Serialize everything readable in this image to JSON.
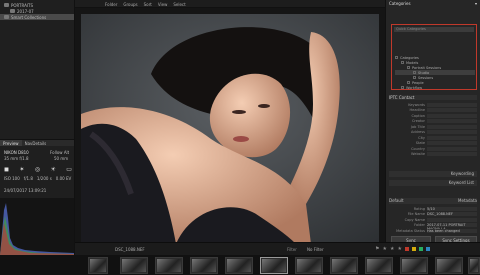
{
  "left_panel": {
    "tree": [
      {
        "label": "PORTRAITS",
        "selected": false,
        "level": 0
      },
      {
        "label": "2017-07",
        "selected": false,
        "level": 1
      },
      {
        "label": "Smart Collections",
        "selected": true,
        "level": 0
      }
    ],
    "tabs": [
      {
        "label": "Preview"
      },
      {
        "label": "NavDetails"
      }
    ],
    "camera": {
      "model": "NIKON D810",
      "lens": "35 mm f/1.8",
      "profile": "Follow Alt",
      "meta_right": "50 mm"
    },
    "exif": {
      "iso": "ISO 100",
      "shutter": "1/200 s",
      "aperture": "f/1.8",
      "wb": "1/3",
      "ev": "0.00 EV"
    },
    "date": "24/07/2017 13:09:21"
  },
  "top_bar": {
    "items": [
      "Folder",
      "Groups",
      "Sort",
      "View",
      "Select"
    ]
  },
  "right_panel": {
    "categories_title": "Categories",
    "search_placeholder": "Quick Categories",
    "tree": [
      {
        "label": "Categories",
        "level": 0
      },
      {
        "label": "Models",
        "level": 1
      },
      {
        "label": "Portrait Sessions",
        "level": 2
      },
      {
        "label": "Studio",
        "level": 3
      },
      {
        "label": "Sessions",
        "level": 3
      },
      {
        "label": "People",
        "level": 2
      },
      {
        "label": "Workflow",
        "level": 1
      }
    ],
    "fields_title": "IPTC Contact",
    "fields": [
      {
        "label": "Keywords",
        "value": ""
      },
      {
        "label": "Headline",
        "value": ""
      },
      {
        "label": "Caption",
        "value": ""
      },
      {
        "label": "Creator",
        "value": ""
      },
      {
        "label": "Job Title",
        "value": ""
      },
      {
        "label": "Address",
        "value": ""
      },
      {
        "label": "City",
        "value": ""
      },
      {
        "label": "State",
        "value": ""
      },
      {
        "label": "Country",
        "value": ""
      },
      {
        "label": "Website",
        "value": ""
      }
    ],
    "sections": [
      "Keywording",
      "Keyword List"
    ],
    "metadata": {
      "title": "Metadata",
      "preset_label": "Default",
      "rows": [
        {
          "label": "Rating",
          "value": "5/10"
        },
        {
          "label": "File Name",
          "value": "DSC_1088.NEF"
        },
        {
          "label": "Copy Name",
          "value": ""
        },
        {
          "label": "Folder",
          "value": "2017-07-11 PORTRAIT MAGNA LA"
        },
        {
          "label": "Metadata Status",
          "value": "Has been changed"
        }
      ]
    },
    "buttons": {
      "sync": "Sync",
      "sync_settings": "Sync Settings"
    }
  },
  "bottom_bar": {
    "path": "DSC_1088.NEF",
    "filter_label": "Filter",
    "filter_value": "No Filter"
  },
  "colors": {
    "accent": "#c0392b",
    "panel_bg": "#262626",
    "selection": "#4a4a4a"
  }
}
